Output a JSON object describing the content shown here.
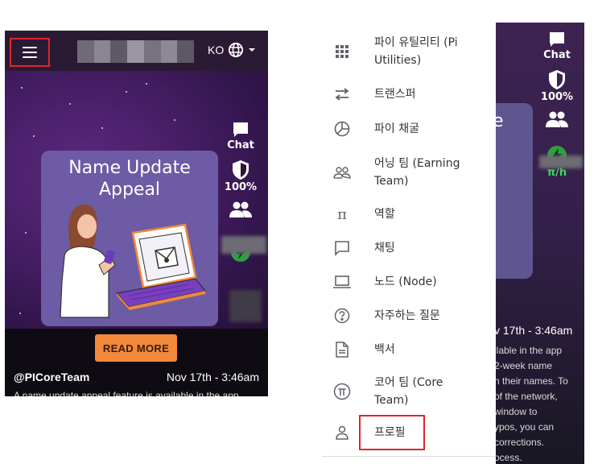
{
  "left_screen": {
    "header": {
      "lang_code": "KO"
    },
    "side_icons": [
      {
        "icon": "chat-icon",
        "label": "Chat"
      },
      {
        "icon": "shield-icon",
        "label": "100%"
      },
      {
        "icon": "team-icon",
        "label": ""
      },
      {
        "icon": "lightning-icon",
        "label": ""
      }
    ],
    "card": {
      "title_line1": "Name Update",
      "title_line2": "Appeal"
    },
    "read_more_label": "READ MORE",
    "post": {
      "author": "@PICoreTeam",
      "date": "Nov 17th - 3:46am",
      "snippet": "A name update appeal feature is available in the app"
    }
  },
  "drawer": {
    "items": [
      {
        "icon": "grid-icon",
        "label_line1": "파이 유틸리티 (Pi",
        "label_line2": "Utilities)"
      },
      {
        "icon": "transfer-icon",
        "label_line1": "트랜스퍼",
        "label_line2": ""
      },
      {
        "icon": "mining-icon",
        "label_line1": "파이 채굴",
        "label_line2": ""
      },
      {
        "icon": "earning-team-icon",
        "label_line1": "어닝 팀 (Earning",
        "label_line2": "Team)"
      },
      {
        "icon": "pi-icon",
        "label_line1": "역할",
        "label_line2": ""
      },
      {
        "icon": "chat-bubble-icon",
        "label_line1": "채팅",
        "label_line2": ""
      },
      {
        "icon": "laptop-icon",
        "label_line1": "노드 (Node)",
        "label_line2": ""
      },
      {
        "icon": "help-icon",
        "label_line1": "자주하는 질문",
        "label_line2": ""
      },
      {
        "icon": "document-icon",
        "label_line1": "백서",
        "label_line2": ""
      },
      {
        "icon": "core-team-icon",
        "label_line1": "코어 팀 (Core",
        "label_line2": "Team)"
      },
      {
        "icon": "person-icon",
        "label_line1": "프로필",
        "label_line2": ""
      }
    ]
  },
  "right_screen": {
    "side_icons": [
      {
        "icon": "chat-icon",
        "label": "Chat"
      },
      {
        "icon": "shield-icon",
        "label": "100%"
      },
      {
        "icon": "team-icon",
        "label": ""
      },
      {
        "icon": "lightning-icon",
        "label": "π/h"
      }
    ],
    "card_letter": "e",
    "date": "v 17th - 3:46am",
    "text_lines": [
      "ilable in the app",
      "2-week name",
      "n their names. To",
      "of the network,",
      "window to",
      "ypos, you can",
      "corrections.",
      "ocess."
    ]
  },
  "colors": {
    "highlight": "#e0262c",
    "button": "#f2893a",
    "card": "#6d5ba6",
    "accent_green": "#2ea043"
  }
}
